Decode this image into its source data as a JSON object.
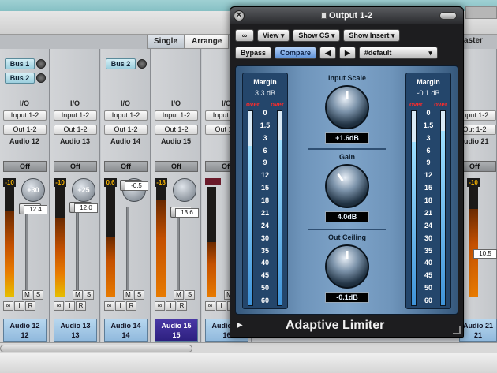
{
  "view_tabs": [
    "Single",
    "Arrange"
  ],
  "master_label": "aster",
  "strips": [
    {
      "sends": [
        "Bus 1",
        "Bus 2"
      ],
      "io": "I/O",
      "input": "Input 1-2",
      "output": "Out 1-2",
      "name": "Audio 12",
      "off": "Off",
      "peak": "-10",
      "pan": "+30",
      "fader": "12.4",
      "m": "M",
      "s": "S",
      "r": "R",
      "i": "I",
      "line1": "Audio 12",
      "line2": "12"
    },
    {
      "sends": [],
      "io": "I/O",
      "input": "Input 1-2",
      "output": "Out 1-2",
      "name": "Audio 13",
      "off": "Off",
      "peak": "-10",
      "pan": "+25",
      "fader": "12.0",
      "m": "M",
      "s": "S",
      "r": "R",
      "i": "I",
      "line1": "Audio 13",
      "line2": "13"
    },
    {
      "sends": [
        "Bus 2"
      ],
      "io": "I/O",
      "input": "Input 1-2",
      "output": "Out 1-2",
      "name": "Audio 14",
      "off": "Off",
      "peak": "0.6",
      "pan": "",
      "fader": "-0.5",
      "m": "M",
      "s": "S",
      "r": "R",
      "i": "I",
      "line1": "Audio 14",
      "line2": "14"
    },
    {
      "sends": [],
      "io": "I/O",
      "input": "Input 1-2",
      "output": "Out 1-2",
      "name": "Audio 15",
      "off": "Off",
      "peak": "-18",
      "pan": "",
      "fader": "13.6",
      "m": "M",
      "s": "S",
      "r": "R",
      "i": "I",
      "line1": "Audio 15",
      "line2": "15"
    },
    {
      "sends": [],
      "io": "I/O",
      "input": "Input 1-2",
      "output": "Out 1-2",
      "name": "",
      "off": "Off",
      "peak": "",
      "pan": "",
      "fader": "",
      "m": "M",
      "s": "S",
      "r": "R",
      "i": "I",
      "line1": "Audio 16",
      "line2": "16"
    }
  ],
  "right_strip": {
    "input": "Input 1-2",
    "output": "Out 1-2",
    "name": "Audio 21",
    "off": "Off",
    "peak": "-10",
    "fader": "10.5",
    "line1": "Audio 21",
    "line2": "21"
  },
  "plugin": {
    "title": "Output 1-2",
    "close": "✕",
    "link": "∞",
    "view": "View ▾",
    "show_cs": "Show CS ▾",
    "show_insert": "Show Insert ▾",
    "bypass": "Bypass",
    "compare": "Compare",
    "prev": "◀",
    "next": "▶",
    "preset": "#default",
    "preset_arrow": "▾",
    "left_meter": {
      "title": "Margin",
      "value": "3.3 dB",
      "over1": "over",
      "over2": "over",
      "level_l": 0.82,
      "level_r": 0.85
    },
    "right_meter": {
      "title": "Margin",
      "value": "-0.1 dB",
      "over1": "over",
      "over2": "over",
      "level_l": 0.84,
      "level_r": 0.9
    },
    "scale": [
      "0",
      "1.5",
      "3",
      "6",
      "9",
      "12",
      "15",
      "18",
      "21",
      "24",
      "30",
      "35",
      "40",
      "45",
      "50",
      "60"
    ],
    "input_scale": {
      "label": "Input Scale",
      "value": "+1.6dB"
    },
    "gain": {
      "label": "Gain",
      "value": "4.0dB"
    },
    "out_ceiling": {
      "label": "Out Ceiling",
      "value": "-0.1dB"
    },
    "name": "Adaptive Limiter",
    "play": "▶"
  }
}
